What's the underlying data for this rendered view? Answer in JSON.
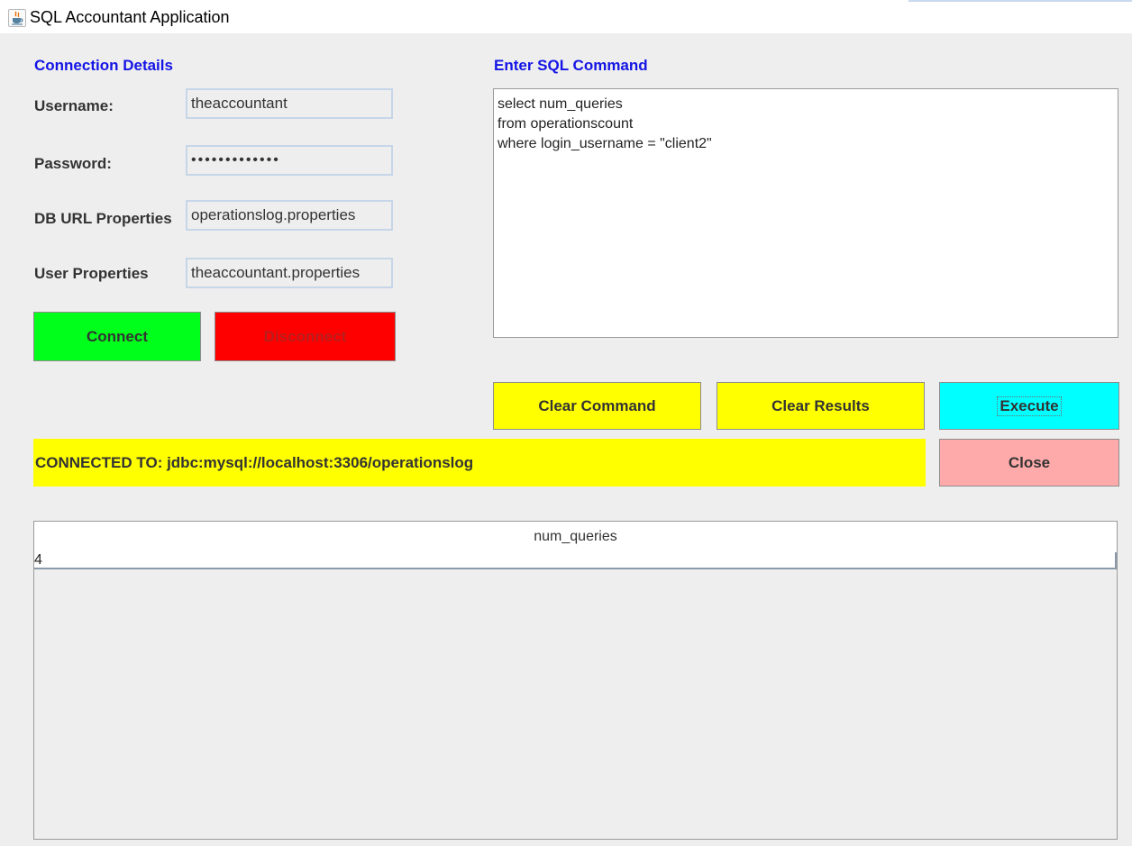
{
  "window": {
    "title": "SQL Accountant Application",
    "icon": "java-cup-icon"
  },
  "connection": {
    "heading": "Connection Details",
    "username_label": "Username:",
    "username_value": "theaccountant",
    "password_label": "Password:",
    "password_value": "•••••••••••••",
    "db_url_label": "DB URL Properties",
    "db_url_value": "operationslog.properties",
    "user_props_label": "User Properties",
    "user_props_value": "theaccountant.properties",
    "connect_label": "Connect",
    "disconnect_label": "Disconnect"
  },
  "sql": {
    "heading": "Enter SQL Command",
    "command": "select num_queries\nfrom operationscount\nwhere login_username = \"client2\""
  },
  "actions": {
    "clear_command_label": "Clear Command",
    "clear_results_label": "Clear Results",
    "execute_label": "Execute",
    "close_label": "Close"
  },
  "status": {
    "text": "CONNECTED TO: jdbc:mysql://localhost:3306/operationslog"
  },
  "results": {
    "columns": [
      "num_queries"
    ],
    "rows": [
      [
        "4"
      ]
    ]
  },
  "colors": {
    "heading": "#1414e6",
    "connect": "#00ff1a",
    "disconnect": "#ff0000",
    "yellow": "#ffff00",
    "execute": "#00ffff",
    "close": "#ffaaaa"
  }
}
